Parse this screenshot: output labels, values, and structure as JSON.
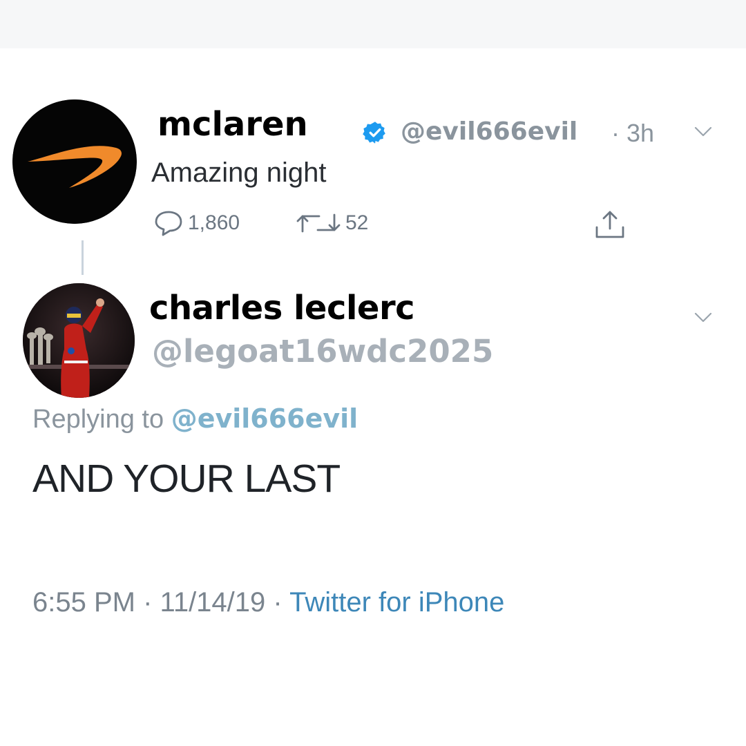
{
  "reply_parent": {
    "display_name": "mclaren",
    "handle": "@evil666evil",
    "time": "· 3h",
    "text": "Amazing night",
    "reply_count": "1,860",
    "retweet_count": "52",
    "verified_icon": "verified-badge-icon",
    "avatar": "mclaren-logo-avatar"
  },
  "tweet": {
    "display_name": "charles leclerc",
    "handle": "@legoat16wdc2025",
    "replying_label": "Replying to",
    "replying_handle": "@evil666evil",
    "text": "AND YOUR LAST",
    "time": "6:55 PM",
    "date": "11/14/19",
    "source": "Twitter for iPhone",
    "separator": "·",
    "avatar": "driver-photo-avatar"
  },
  "colors": {
    "name": "#000000",
    "handle": "#a8b0b8",
    "link": "#3d87b8",
    "verified": "#1d9bf0",
    "mclaren_orange": "#f08a2b"
  }
}
